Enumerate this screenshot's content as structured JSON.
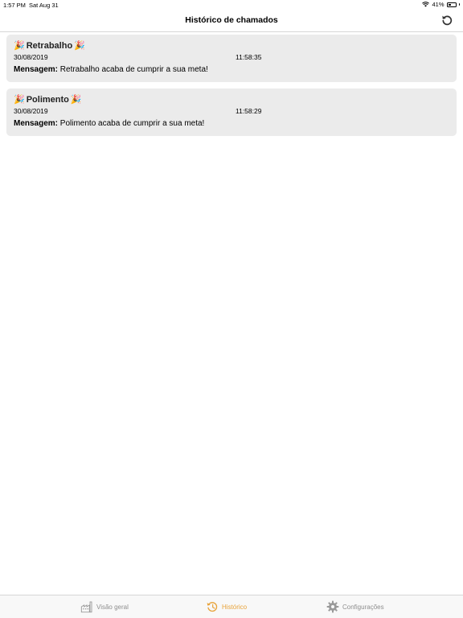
{
  "status_bar": {
    "time": "1:57 PM",
    "date": "Sat Aug 31",
    "battery": "41%",
    "battery_level": 0.41
  },
  "nav": {
    "title": "Histórico de chamados",
    "refresh_icon": "refresh-icon"
  },
  "calls": [
    {
      "title": "Retrabalho",
      "date": "30/08/2019",
      "time": "11:58:35",
      "message_label": "Mensagem:",
      "message": " Retrabalho acaba de cumprir a sua meta!"
    },
    {
      "title": "Polimento",
      "date": "30/08/2019",
      "time": "11:58:29",
      "message_label": "Mensagem:",
      "message": " Polimento acaba de cumprir a sua meta!"
    }
  ],
  "tabs": [
    {
      "label": "Visão geral",
      "icon": "factory-icon",
      "active": false
    },
    {
      "label": "Histórico",
      "icon": "history-icon",
      "active": true
    },
    {
      "label": "Configurações",
      "icon": "gear-icon",
      "active": false
    }
  ],
  "colors": {
    "accent": "#e8a33a",
    "card_bg": "#ebebeb",
    "inactive": "#8e8e8e"
  }
}
